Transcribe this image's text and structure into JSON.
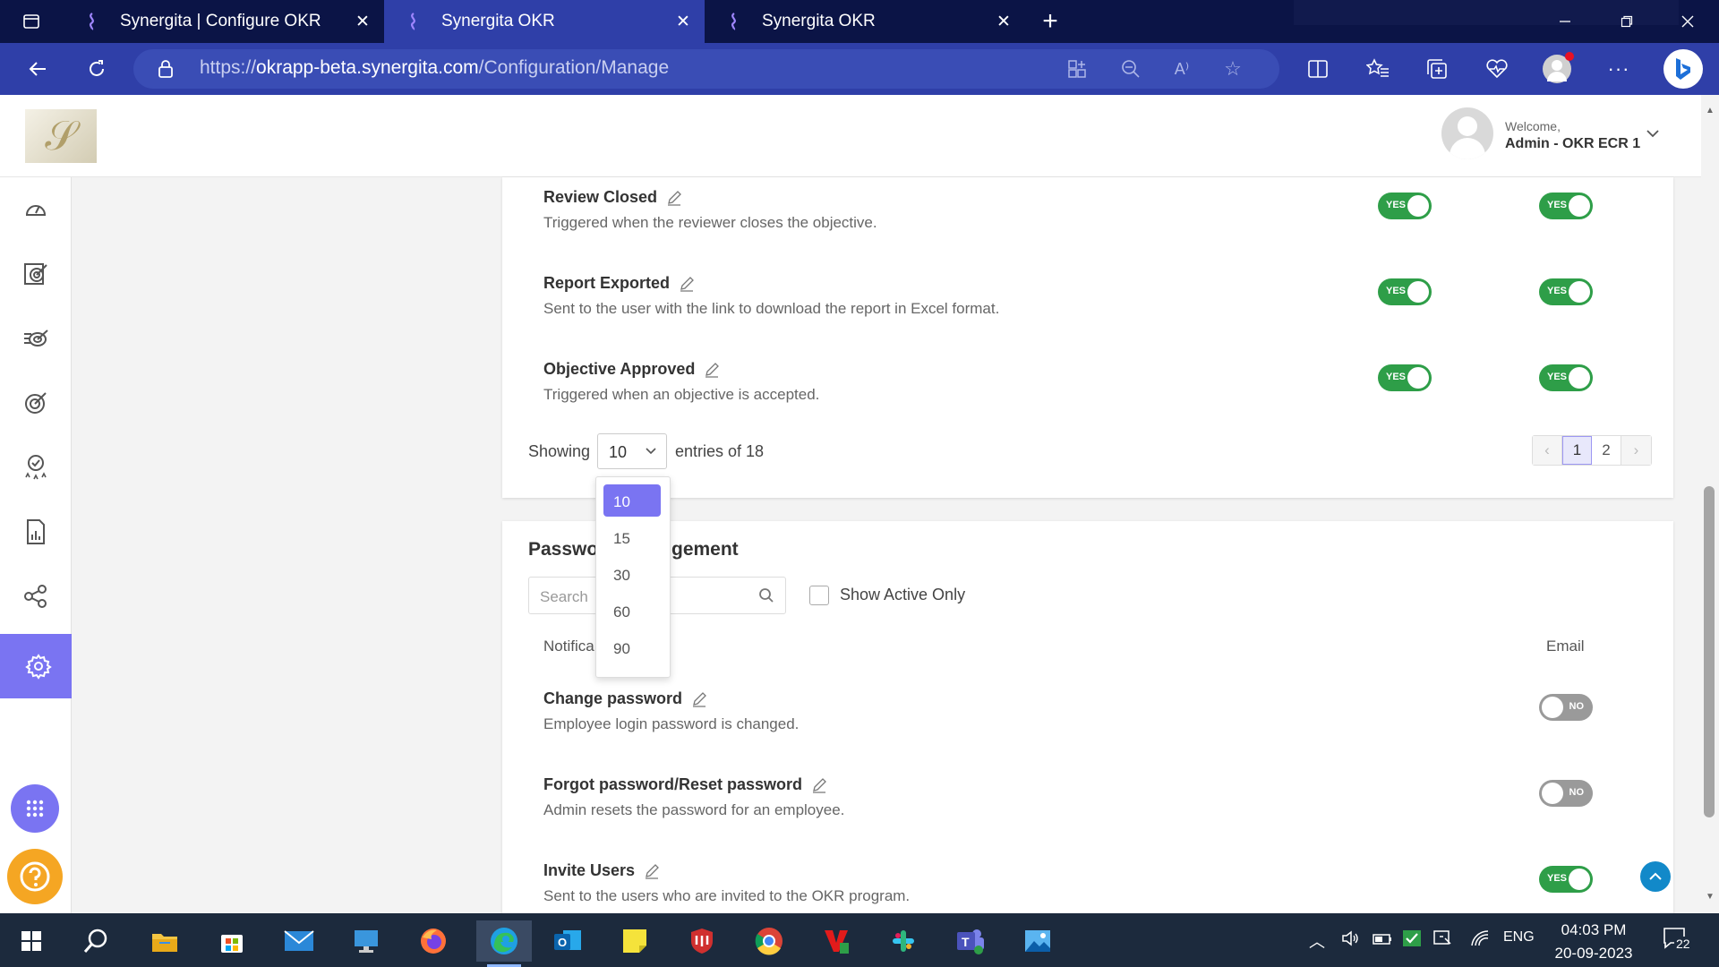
{
  "browser": {
    "tabs": [
      {
        "title": "Synergita | Configure OKR"
      },
      {
        "title": "Synergita OKR"
      },
      {
        "title": "Synergita OKR"
      }
    ],
    "url_base": "https://",
    "url_host": "okrapp-beta.synergita.com",
    "url_path": "/Configuration/Manage"
  },
  "header": {
    "welcome": "Welcome,",
    "user_name": "Admin - OKR ECR 1"
  },
  "sidebar": {
    "items": [
      {
        "icon": "dashboard-icon"
      },
      {
        "icon": "objectives-icon"
      },
      {
        "icon": "alignment-icon"
      },
      {
        "icon": "target-icon"
      },
      {
        "icon": "review-badge-icon"
      },
      {
        "icon": "report-icon"
      },
      {
        "icon": "network-icon"
      },
      {
        "icon": "settings-icon",
        "active": true
      }
    ],
    "apps_icon": "grid-icon",
    "help_icon": "help-icon"
  },
  "section1": {
    "rows": [
      {
        "title": "Review Closed",
        "desc": "Triggered when the reviewer closes the objective.",
        "toggle1": "YES",
        "toggle2": "YES"
      },
      {
        "title": "Report Exported",
        "desc": "Sent to the user with the link to download the report in Excel format.",
        "toggle1": "YES",
        "toggle2": "YES"
      },
      {
        "title": "Objective Approved",
        "desc": "Triggered when an objective is accepted.",
        "toggle1": "YES",
        "toggle2": "YES"
      }
    ],
    "showing_label": "Showing",
    "page_size": "10",
    "entries_label": "entries of 18",
    "pager": {
      "prev": "‹",
      "pages": [
        "1",
        "2"
      ],
      "next": "›",
      "current": "1"
    }
  },
  "page_size_menu": {
    "options": [
      "10",
      "15",
      "30",
      "60",
      "90"
    ],
    "selected": "10"
  },
  "section2": {
    "title_left": "Passwo",
    "title_right": "gement",
    "search_placeholder": "Search",
    "show_active_label": "Show Active Only",
    "col_notification": "Notifica",
    "col_email": "Email",
    "rows": [
      {
        "title": "Change password",
        "desc": "Employee login password is changed.",
        "toggle": "NO"
      },
      {
        "title": "Forgot password/Reset password",
        "desc": "Admin resets the password for an employee.",
        "toggle": "NO"
      },
      {
        "title": "Invite Users",
        "desc": "Sent to the users who are invited to the OKR program.",
        "toggle": "YES"
      }
    ]
  },
  "taskbar": {
    "lang": "ENG",
    "time": "04:03 PM",
    "date": "20-09-2023",
    "notif_count": "22"
  },
  "colors": {
    "accent": "#7a74f2",
    "toggle_on": "#2e9e48",
    "toggle_off": "#9a9a9a",
    "browser_dark": "#0b1446",
    "browser_bar": "#2f3fa8"
  }
}
